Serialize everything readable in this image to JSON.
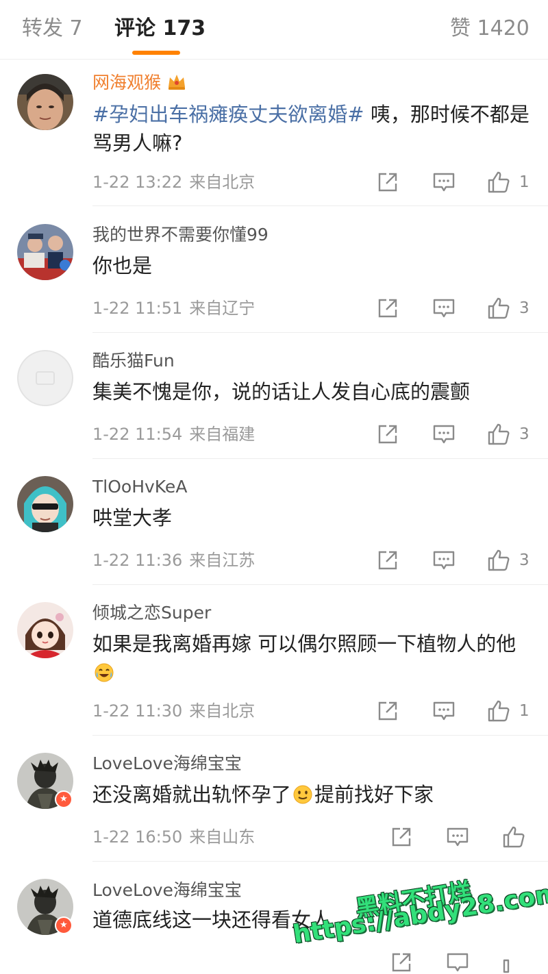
{
  "tabs": {
    "repost": "转发 7",
    "comments": "评论 173",
    "likes": "赞 1420"
  },
  "accent_color": "#ff8200",
  "hashtag_color": "#4a6fa5",
  "vip_name_color": "#f07f2e",
  "comments": [
    {
      "user": "网海观猴",
      "vip": true,
      "badge_icon": "crown-icon",
      "hashtag": "#孕妇出车祸瘫痪丈夫欲离婚#",
      "text": " 咦，那时候不都是骂男人嘛?",
      "time": "1-22 13:22",
      "location": "来自北京",
      "likes": "1"
    },
    {
      "user": "我的世界不需要你懂99",
      "text": "你也是",
      "time": "1-22 11:51",
      "location": "来自辽宁",
      "likes": "3"
    },
    {
      "user": "酷乐猫Fun",
      "text": "集美不愧是你，说的话让人发自心底的震颤",
      "time": "1-22 11:54",
      "location": "来自福建",
      "likes": "3"
    },
    {
      "user": "TlOoHvKeA",
      "text": "哄堂大孝",
      "time": "1-22 11:36",
      "location": "来自江苏",
      "likes": "3"
    },
    {
      "user": "倾城之恋Super",
      "text": "如果是我离婚再嫁 可以偶尔照顾一下植物人的他",
      "emoji": "laugh-cry-emoji",
      "time": "1-22 11:30",
      "location": "来自北京",
      "likes": "1"
    },
    {
      "user": "LoveLove海绵宝宝",
      "text_before": "还没离婚就出轨怀孕了",
      "emoji": "smile-emoji",
      "text_after": "提前找好下家",
      "time": "1-22 16:50",
      "location": "来自山东",
      "likes": ""
    },
    {
      "user": "LoveLove海绵宝宝",
      "text": "道德底线这一块还得看女人"
    }
  ],
  "watermark": {
    "line1": "黑料不打烊",
    "line2": "https://abdy28.com"
  }
}
